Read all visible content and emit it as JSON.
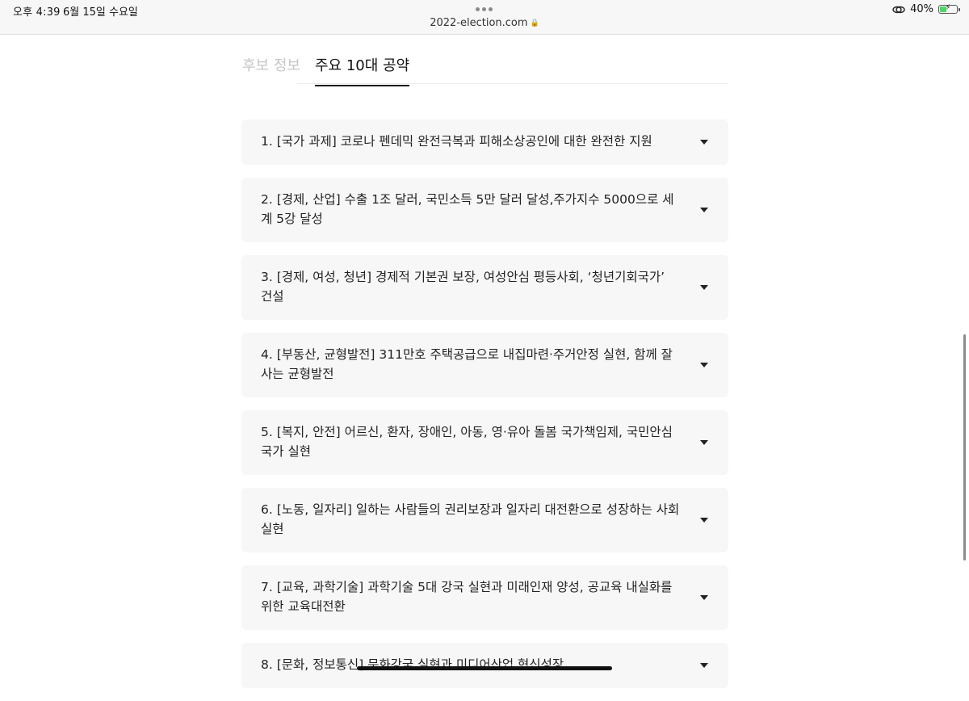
{
  "status_bar": {
    "time": "오후 4:39",
    "date": "6월 15일 수요일",
    "url": "2022-election.com",
    "battery_percent_label": "40%",
    "battery_level": 0.4
  },
  "tabs": [
    {
      "label": "후보 정보",
      "active": false
    },
    {
      "label": "주요 10대 공약",
      "active": true
    }
  ],
  "pledges": [
    {
      "text": "1. [국가 과제] 코로나 펜데믹 완전극복과 피해소상공인에 대한 완전한 지원"
    },
    {
      "text": "2. [경제, 산업] 수출 1조 달러, 국민소득 5만 달러 달성,주가지수 5000으로 세계 5강 달성"
    },
    {
      "text": "3. [경제, 여성, 청년] 경제적 기본권 보장, 여성안심 평등사회, ‘청년기회국가’ 건설"
    },
    {
      "text": "4. [부동산, 균형발전] 311만호 주택공급으로 내집마련·주거안정 실현, 함께 잘 사는 균형발전"
    },
    {
      "text": "5. [복지, 안전] 어르신, 환자, 장애인, 아동, 영·유아 돌봄 국가책임제, 국민안심국가 실현"
    },
    {
      "text": "6. [노동, 일자리] 일하는 사람들의 권리보장과 일자리 대전환으로 성장하는 사회 실현"
    },
    {
      "text": "7. [교육, 과학기술] 과학기술 5대 강국 실현과 미래인재 양성, 공교육 내실화를 위한 교육대전환"
    },
    {
      "text": "8. [문화, 정보통신] 문화강국 실현과 미디어산업 혁신성장"
    }
  ]
}
